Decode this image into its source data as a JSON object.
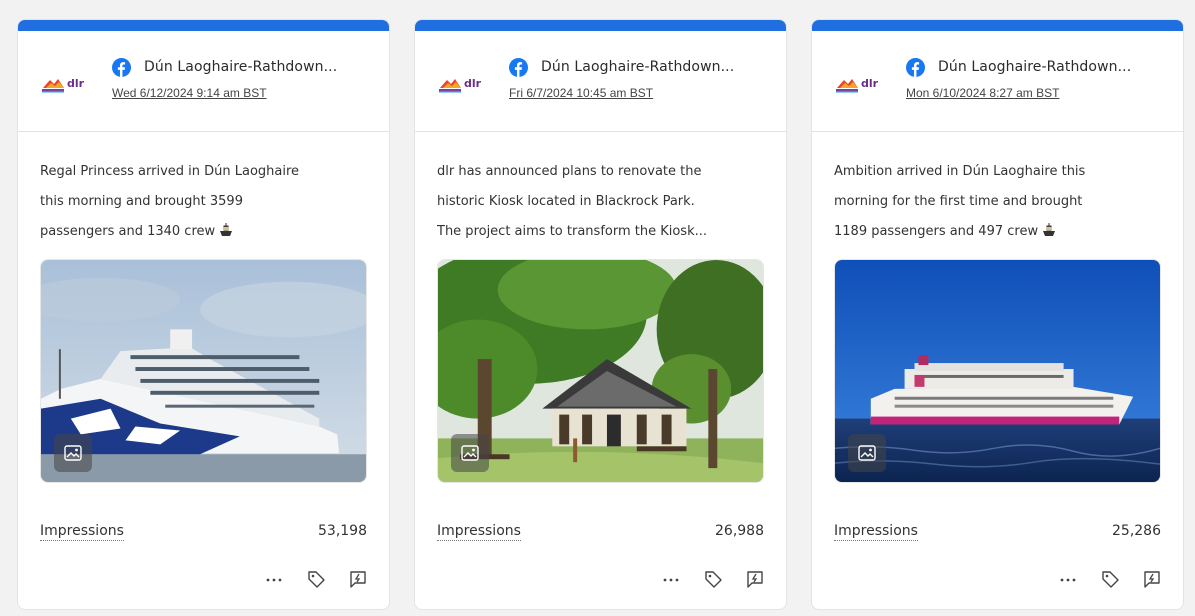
{
  "cards": [
    {
      "page_name": "Dún Laoghaire-Rathdown...",
      "date": "Wed 6/12/2024 9:14 am BST",
      "text_lines": [
        "Regal Princess arrived in Dún Laoghaire",
        "this morning and brought 3599",
        "passengers and 1340 crew"
      ],
      "media_type": "ship-photo",
      "metric_label": "Impressions",
      "metric_value": "53,198"
    },
    {
      "page_name": "Dún Laoghaire-Rathdown...",
      "date": "Fri 6/7/2024 10:45 am BST",
      "text_lines": [
        "dlr has announced plans to renovate the",
        "historic Kiosk located in Blackrock Park.",
        "The project aims to transform the Kiosk..."
      ],
      "media_type": "park-photo",
      "metric_label": "Impressions",
      "metric_value": "26,988"
    },
    {
      "page_name": "Dún Laoghaire-Rathdown...",
      "date": "Mon 6/10/2024 8:27 am BST",
      "text_lines": [
        "Ambition arrived in Dún Laoghaire this",
        "morning for the first time and brought",
        "1189 passengers and 497 crew"
      ],
      "media_type": "ship-photo",
      "metric_label": "Impressions",
      "metric_value": "25,286"
    }
  ],
  "logo_text": "dlr",
  "icons": {
    "network": "facebook-icon",
    "media_badge": "image-icon",
    "more": "more-icon",
    "tag": "tag-icon",
    "reply": "reply-icon",
    "emoji": "ship-emoji"
  },
  "colors": {
    "accent_bar": "#1f6fe0",
    "facebook": "#1877f2",
    "background": "#f2f2f2"
  }
}
